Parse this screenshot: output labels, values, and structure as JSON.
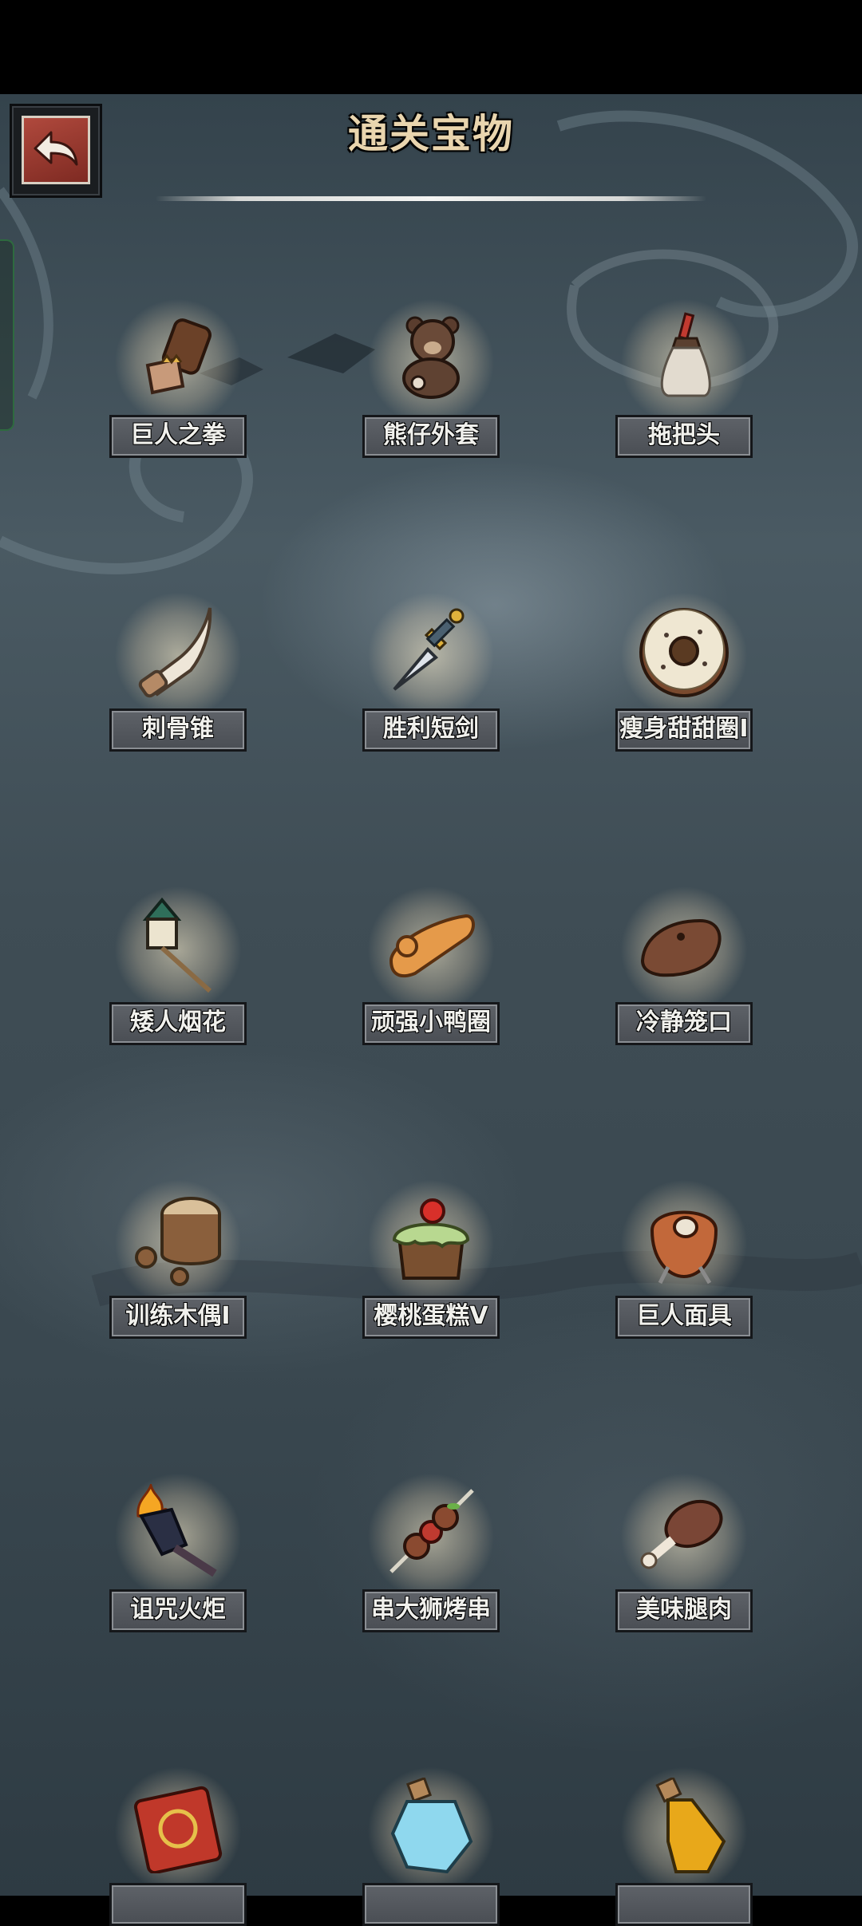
{
  "header": {
    "title": "通关宝物"
  },
  "items": [
    {
      "label": "巨人之拳",
      "icon": "giant-fist-icon"
    },
    {
      "label": "熊仔外套",
      "icon": "teddy-bear-icon"
    },
    {
      "label": "拖把头",
      "icon": "mop-head-icon"
    },
    {
      "label": "刺骨锥",
      "icon": "bone-awl-icon"
    },
    {
      "label": "胜利短剑",
      "icon": "dagger-icon"
    },
    {
      "label": "瘦身甜甜圈I",
      "icon": "donut-icon"
    },
    {
      "label": "矮人烟花",
      "icon": "firework-icon"
    },
    {
      "label": "顽强小鸭圈",
      "icon": "duck-ring-icon"
    },
    {
      "label": "冷静笼口",
      "icon": "muzzle-icon"
    },
    {
      "label": "训练木偶I",
      "icon": "wooden-dummy-icon"
    },
    {
      "label": "樱桃蛋糕V",
      "icon": "cherry-cake-icon"
    },
    {
      "label": "巨人面具",
      "icon": "giant-mask-icon"
    },
    {
      "label": "诅咒火炬",
      "icon": "cursed-torch-icon"
    },
    {
      "label": "串大狮烤串",
      "icon": "kebab-icon"
    },
    {
      "label": "美味腿肉",
      "icon": "meat-leg-icon"
    },
    {
      "label": "",
      "icon": "spellbook-icon"
    },
    {
      "label": "",
      "icon": "blue-potion-icon"
    },
    {
      "label": "",
      "icon": "yellow-potion-icon"
    }
  ]
}
